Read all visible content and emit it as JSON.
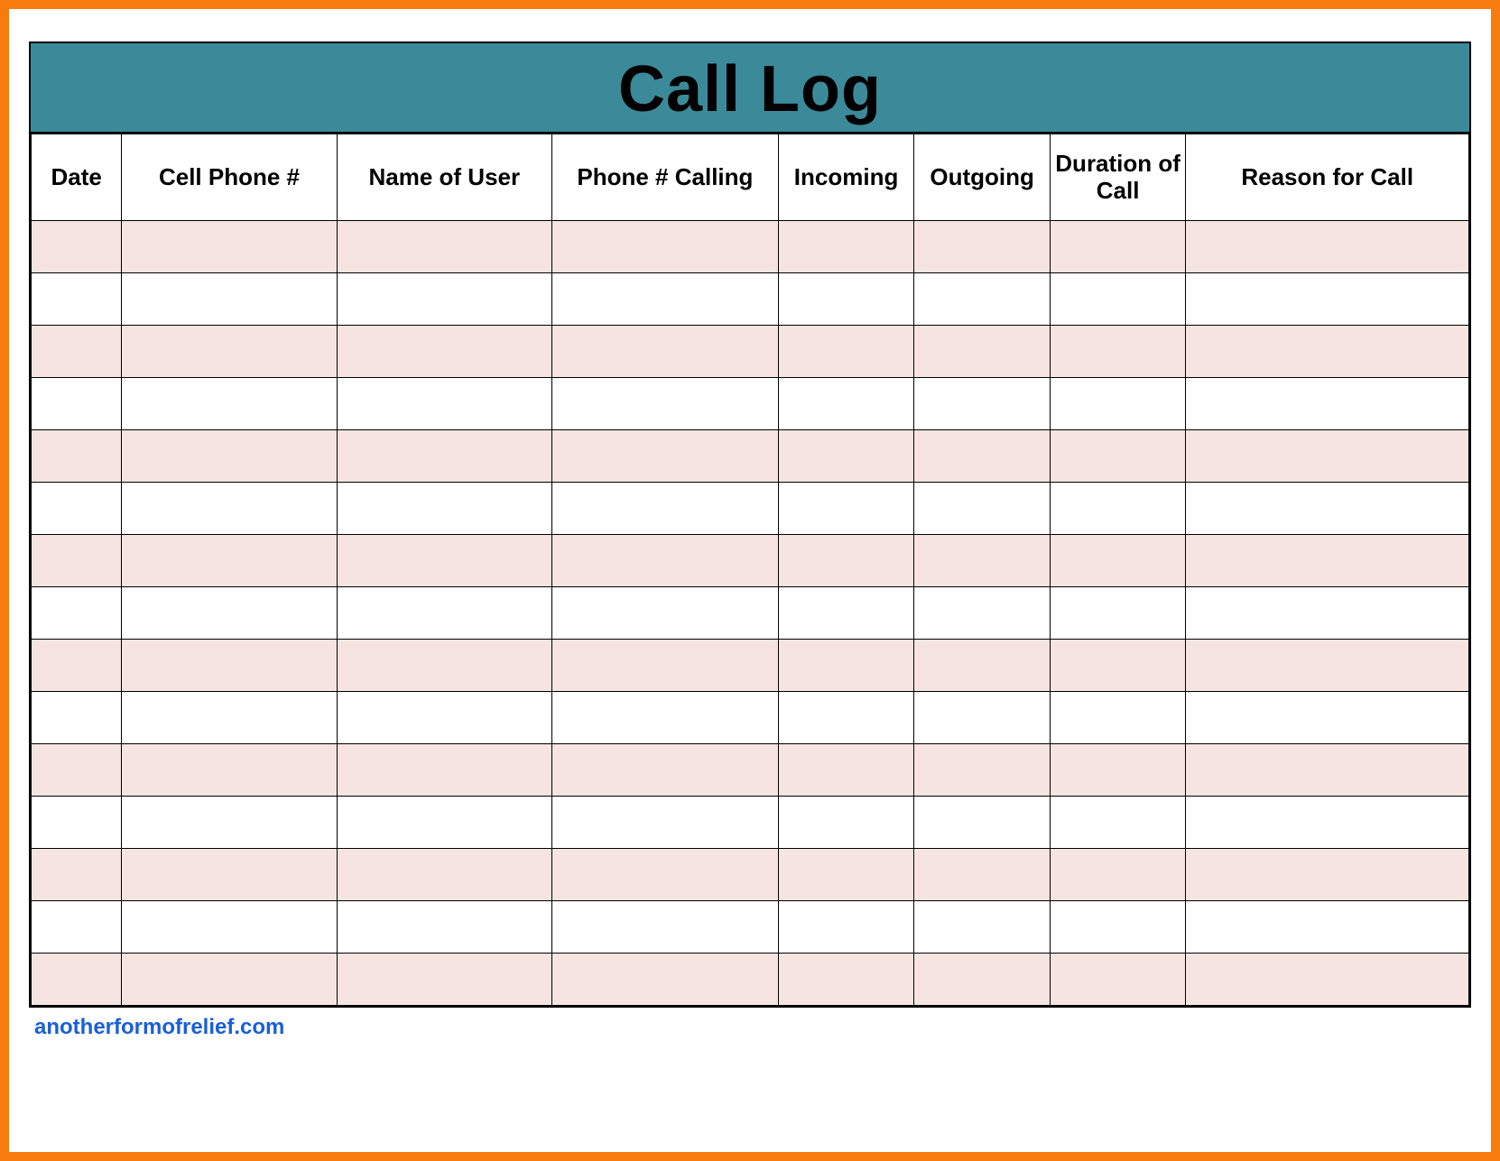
{
  "title": "Call Log",
  "columns": [
    "Date",
    "Cell Phone #",
    "Name of User",
    "Phone # Calling",
    "Incoming",
    "Outgoing",
    "Duration of Call",
    "Reason for Call"
  ],
  "rows": [
    [
      "",
      "",
      "",
      "",
      "",
      "",
      "",
      ""
    ],
    [
      "",
      "",
      "",
      "",
      "",
      "",
      "",
      ""
    ],
    [
      "",
      "",
      "",
      "",
      "",
      "",
      "",
      ""
    ],
    [
      "",
      "",
      "",
      "",
      "",
      "",
      "",
      ""
    ],
    [
      "",
      "",
      "",
      "",
      "",
      "",
      "",
      ""
    ],
    [
      "",
      "",
      "",
      "",
      "",
      "",
      "",
      ""
    ],
    [
      "",
      "",
      "",
      "",
      "",
      "",
      "",
      ""
    ],
    [
      "",
      "",
      "",
      "",
      "",
      "",
      "",
      ""
    ],
    [
      "",
      "",
      "",
      "",
      "",
      "",
      "",
      ""
    ],
    [
      "",
      "",
      "",
      "",
      "",
      "",
      "",
      ""
    ],
    [
      "",
      "",
      "",
      "",
      "",
      "",
      "",
      ""
    ],
    [
      "",
      "",
      "",
      "",
      "",
      "",
      "",
      ""
    ],
    [
      "",
      "",
      "",
      "",
      "",
      "",
      "",
      ""
    ],
    [
      "",
      "",
      "",
      "",
      "",
      "",
      "",
      ""
    ],
    [
      "",
      "",
      "",
      "",
      "",
      "",
      "",
      ""
    ]
  ],
  "footer_link": "anotherformofrelief.com"
}
